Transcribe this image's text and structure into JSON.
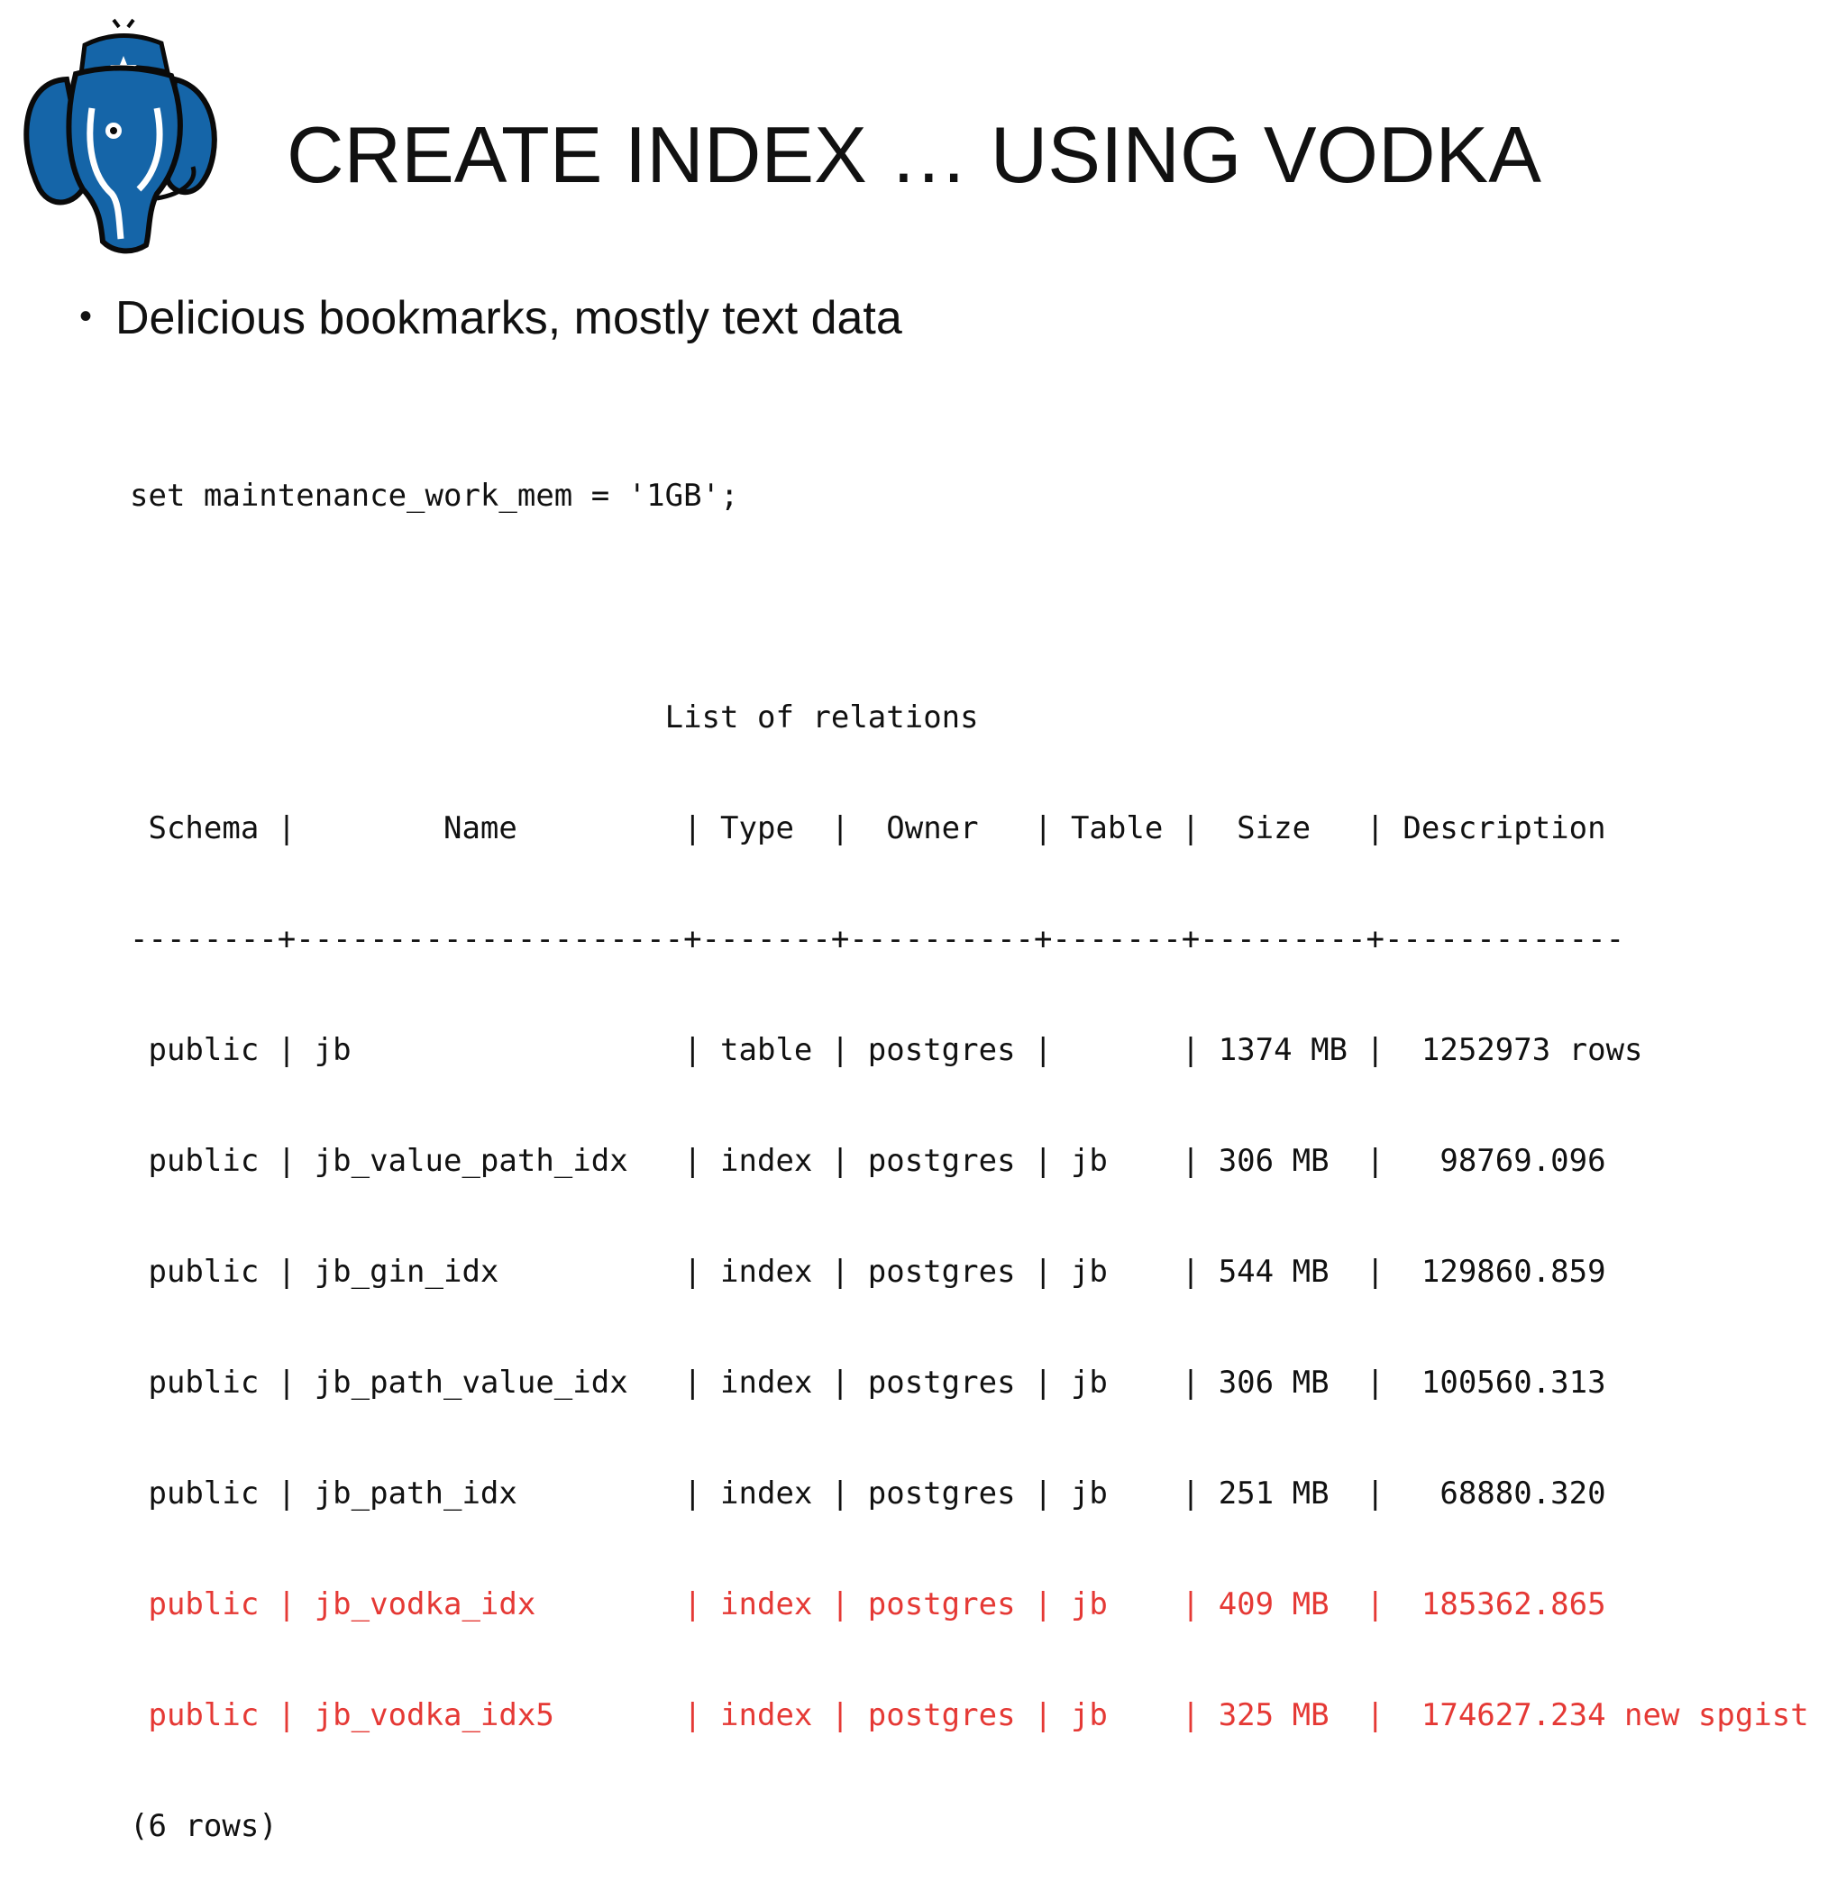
{
  "slide": {
    "title": "CREATE INDEX … USING VODKA",
    "bullet": "Delicious bookmarks, mostly text data"
  },
  "logo": {
    "icon": "postgresql-elephant-icon",
    "color": "#1565a8"
  },
  "terminal": {
    "lines": [
      "set maintenance_work_mem = '1GB';",
      "",
      "                             List of relations",
      " Schema |        Name         | Type  |  Owner   | Table |  Size   | Description",
      "--------+---------------------+-------+----------+-------+---------+-------------",
      " public | jb                  | table | postgres |       | 1374 MB |  1252973 rows",
      " public | jb_value_path_idx   | index | postgres | jb    | 306 MB  |   98769.096",
      " public | jb_gin_idx          | index | postgres | jb    | 544 MB  |  129860.859",
      " public | jb_path_value_idx   | index | postgres | jb    | 306 MB  |  100560.313",
      " public | jb_path_idx         | index | postgres | jb    | 251 MB  |   68880.320",
      " public | jb_vodka_idx        | index | postgres | jb    | 409 MB  |  185362.865",
      " public | jb_vodka_idx5       | index | postgres | jb    | 325 MB  |  174627.234 new spgist",
      "(6 rows)"
    ],
    "highlight_color": "#e53935"
  }
}
